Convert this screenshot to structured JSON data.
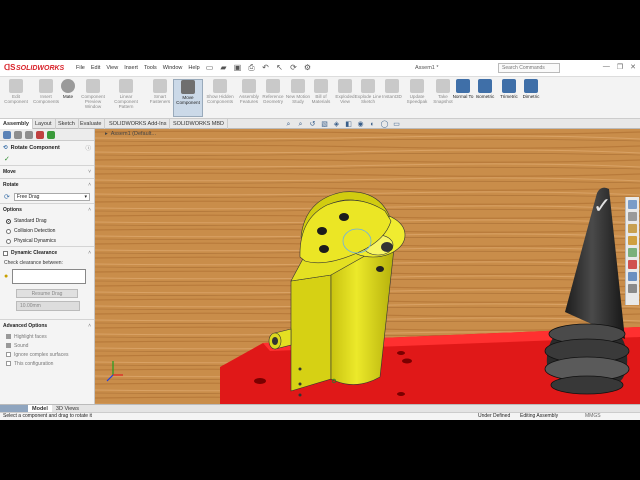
{
  "app": {
    "brand": "SOLIDWORKS",
    "document_title": "Assem1 *",
    "menus": [
      "File",
      "Edit",
      "View",
      "Insert",
      "Tools",
      "Window",
      "Help"
    ],
    "search_placeholder": "Search Commands"
  },
  "ribbon": {
    "buttons": [
      {
        "label": "Edit Component",
        "icon": "edit-component-icon"
      },
      {
        "label": "Insert Components",
        "icon": "insert-components-icon"
      },
      {
        "label": "Mate",
        "icon": "mate-icon"
      },
      {
        "label": "Component Preview Window",
        "icon": "preview-window-icon"
      },
      {
        "label": "Linear Component Pattern",
        "icon": "pattern-icon"
      },
      {
        "label": "Smart Fasteners",
        "icon": "fasteners-icon"
      },
      {
        "label": "Move Component",
        "icon": "move-component-icon"
      },
      {
        "label": "Show Hidden Components",
        "icon": "show-hidden-icon"
      },
      {
        "label": "Assembly Features",
        "icon": "assembly-features-icon"
      },
      {
        "label": "Reference Geometry",
        "icon": "reference-geometry-icon"
      },
      {
        "label": "New Motion Study",
        "icon": "motion-study-icon"
      },
      {
        "label": "Bill of Materials",
        "icon": "bom-icon"
      },
      {
        "label": "Exploded View",
        "icon": "exploded-view-icon"
      },
      {
        "label": "Explode Line Sketch",
        "icon": "explode-line-icon"
      },
      {
        "label": "Instant3D",
        "icon": "instant3d-icon"
      },
      {
        "label": "Update Speedpak",
        "icon": "speedpak-icon"
      },
      {
        "label": "Take Snapshot",
        "icon": "snapshot-icon"
      },
      {
        "label": "Normal To",
        "icon": "normal-to-icon"
      },
      {
        "label": "Isometric",
        "icon": "isometric-icon"
      },
      {
        "label": "Trimetric",
        "icon": "trimetric-icon"
      },
      {
        "label": "Dimetric",
        "icon": "dimetric-icon"
      }
    ]
  },
  "tabs": [
    "Assembly",
    "Layout",
    "Sketch",
    "Evaluate",
    "SOLIDWORKS Add-Ins",
    "SOLIDWORKS MBD"
  ],
  "tree": {
    "label": "Assem1  (Default..."
  },
  "panel": {
    "title": "Rotate Component",
    "move_label": "Move",
    "rotate_label": "Rotate",
    "rotate_option": "Free Drag",
    "options_label": "Options",
    "options": [
      "Standard Drag",
      "Collision Detection",
      "Physical Dynamics"
    ],
    "dynamic_clearance_label": "Dynamic Clearance",
    "check_between_label": "Check clearance between:",
    "resume_drag_label": "Resume Drag",
    "clearance_value": "10.00mm",
    "advanced_label": "Advanced Options",
    "advanced": [
      "Highlight faces",
      "Sound",
      "Ignore complex surfaces",
      "This configuration"
    ]
  },
  "bottom_tabs": [
    "Model",
    "3D Views"
  ],
  "status": {
    "message": "Select a component and drag to rotate it",
    "state": "Under Defined",
    "mode": "Editing Assembly",
    "units": "MMGS"
  },
  "colors": {
    "accent": "#d8222a",
    "part_yellow": "#e6e21a",
    "base_red": "#e01818",
    "wood": "#c98d4a"
  }
}
